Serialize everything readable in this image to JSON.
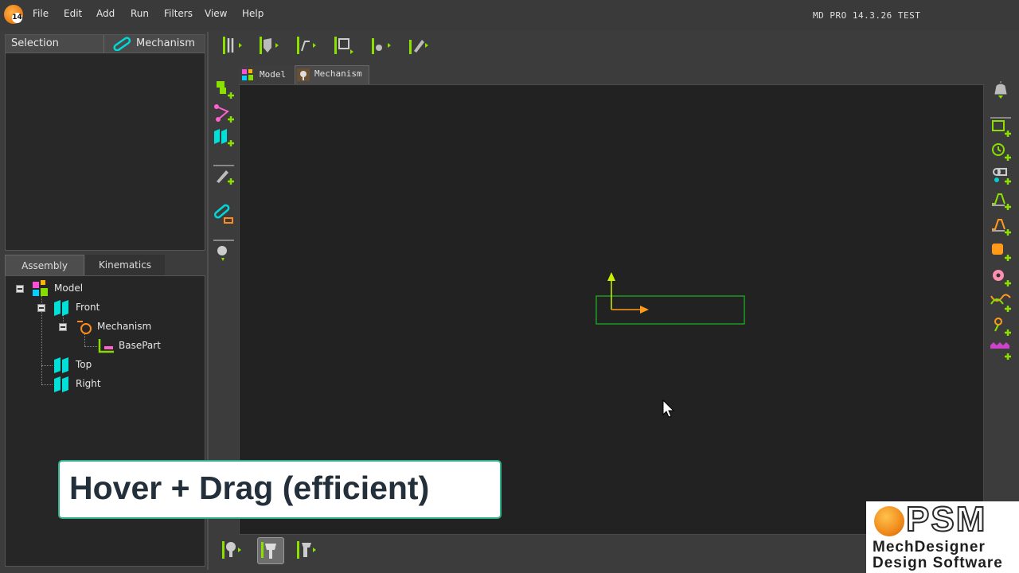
{
  "menu": {
    "items": [
      "File",
      "Edit",
      "Add",
      "Run",
      "Filters",
      "View",
      "Help"
    ],
    "version": "MD PRO 14.3.26   TEST",
    "app_badge": "14"
  },
  "selection_panel": {
    "tab_selection": "Selection",
    "tab_mechanism": "Mechanism"
  },
  "tree_tabs": {
    "assembly": "Assembly",
    "kinematics": "Kinematics"
  },
  "tree": {
    "model": "Model",
    "front": "Front",
    "mechanism": "Mechanism",
    "basepart": "BasePart",
    "top": "Top",
    "right": "Right"
  },
  "doc_tabs": {
    "model": "Model",
    "mechanism": "Mechanism"
  },
  "caption": "Hover + Drag (efficient)",
  "logo": {
    "name": "PSM",
    "line1": "MechDesigner",
    "line2": "Design Software"
  },
  "colors": {
    "accent_green": "#8be000",
    "accent_cyan": "#00e0e0",
    "accent_orange": "#ff9a1a",
    "caption_border": "#2fb08a"
  },
  "icons": {
    "top_toolbar": [
      "motion-direction-icon",
      "shield-icon",
      "line-icon",
      "sketch-box-icon",
      "part-icon",
      "pen-icon"
    ],
    "left_toolbar": [
      "add-part-icon",
      "add-sketch-icon",
      "add-plane-icon",
      "add-pen-icon",
      "link-edit-icon",
      "add-point-icon"
    ],
    "right_toolbar": [
      "notification-icon",
      "add-motor-icon",
      "add-clock-icon",
      "add-cam-icon",
      "add-motion-icon",
      "add-motion2-icon",
      "add-solid-icon",
      "add-gear-icon",
      "add-graph-icon",
      "add-point-icon",
      "add-spring-icon"
    ],
    "bottom_toolbar": [
      "part-run-icon",
      "part-active-icon",
      "gear-run-icon"
    ]
  }
}
